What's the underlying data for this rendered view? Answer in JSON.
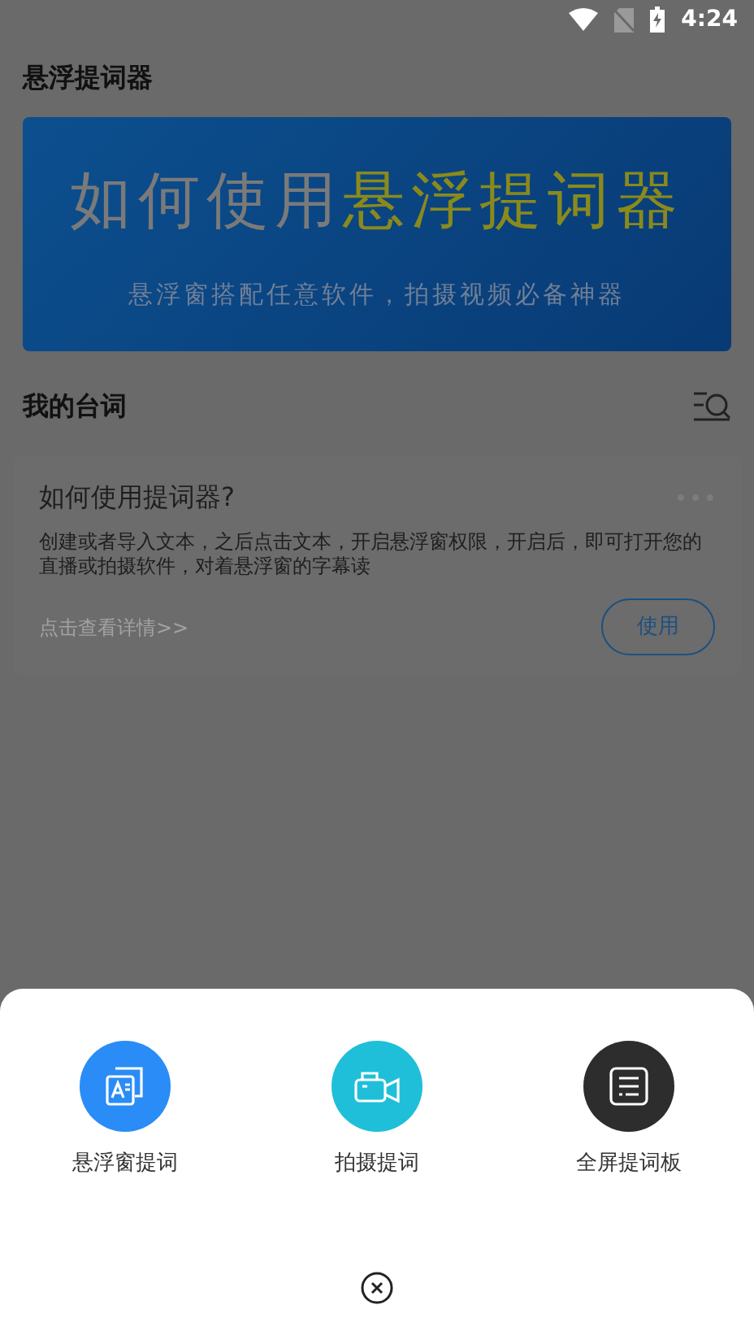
{
  "status_bar": {
    "time": "4:24"
  },
  "app_bar": {
    "title": "悬浮提词器"
  },
  "banner": {
    "title_part_1": "如何使用",
    "title_part_2": "悬浮提词器",
    "subtitle": "悬浮窗搭配任意软件，拍摄视频必备神器"
  },
  "section": {
    "title": "我的台词"
  },
  "scripts": [
    {
      "title": "如何使用提词器?",
      "body": "创建或者导入文本，之后点击文本，开启悬浮窗权限，开启后，即可打开您的直播或拍摄软件，对着悬浮窗的字幕读",
      "link": "点击查看详情>>",
      "button": "使用"
    }
  ],
  "sheet": {
    "actions": [
      {
        "kind": "float",
        "label": "悬浮窗提词",
        "color": "#2a8cf6"
      },
      {
        "kind": "camera",
        "label": "拍摄提词",
        "color": "#1fbfd9"
      },
      {
        "kind": "fullscreen",
        "label": "全屏提词板",
        "color": "#2d2d2d"
      }
    ]
  }
}
